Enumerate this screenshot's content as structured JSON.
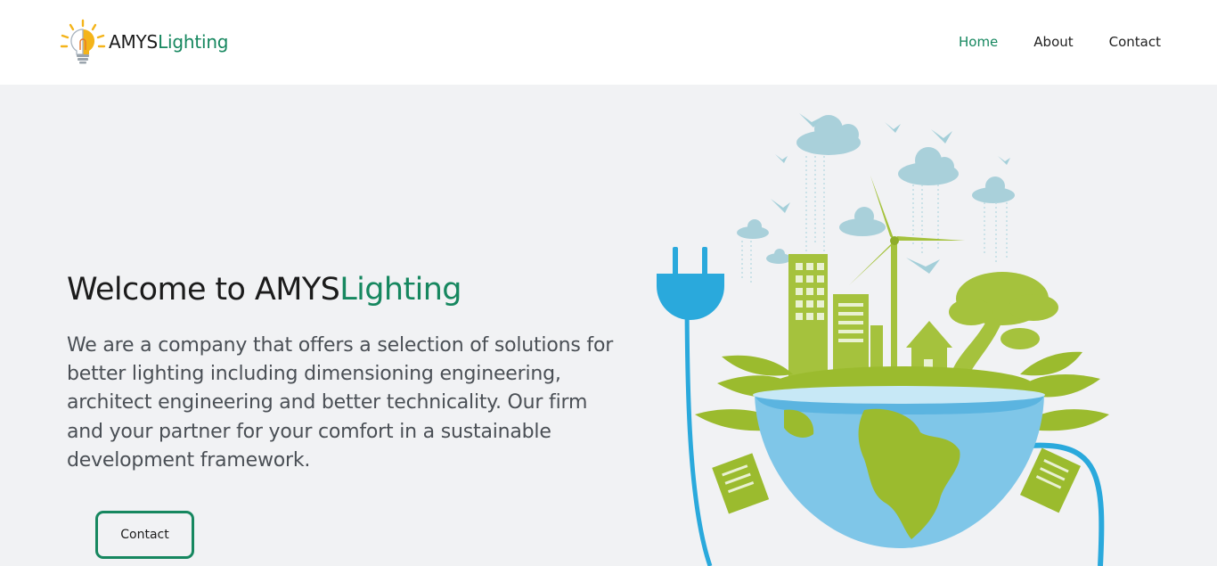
{
  "brand": {
    "name_part1": "AMYS",
    "name_part2": "Lighting",
    "logo_icon": "lightbulb-sun-icon"
  },
  "nav": {
    "items": [
      {
        "label": "Home",
        "active": true
      },
      {
        "label": "About",
        "active": false
      },
      {
        "label": "Contact",
        "active": false
      }
    ]
  },
  "hero": {
    "title_part1": "Welcome to AMYS",
    "title_part2": "Lighting",
    "description": "We are a company that offers a selection of solutions for better lighting including dimensioning engineering, architect engineering and better technicality. Our firm and your partner for your comfort in a sustainable development framework.",
    "cta_label": "Contact",
    "illustration_icon": "eco-earth-plug-illustration"
  },
  "colors": {
    "accent": "#16875f",
    "page_background": "#f1f2f4",
    "navbar_background": "#ffffff",
    "illustration_green": "#9bbb2e",
    "illustration_blue": "#2aa9dc"
  }
}
